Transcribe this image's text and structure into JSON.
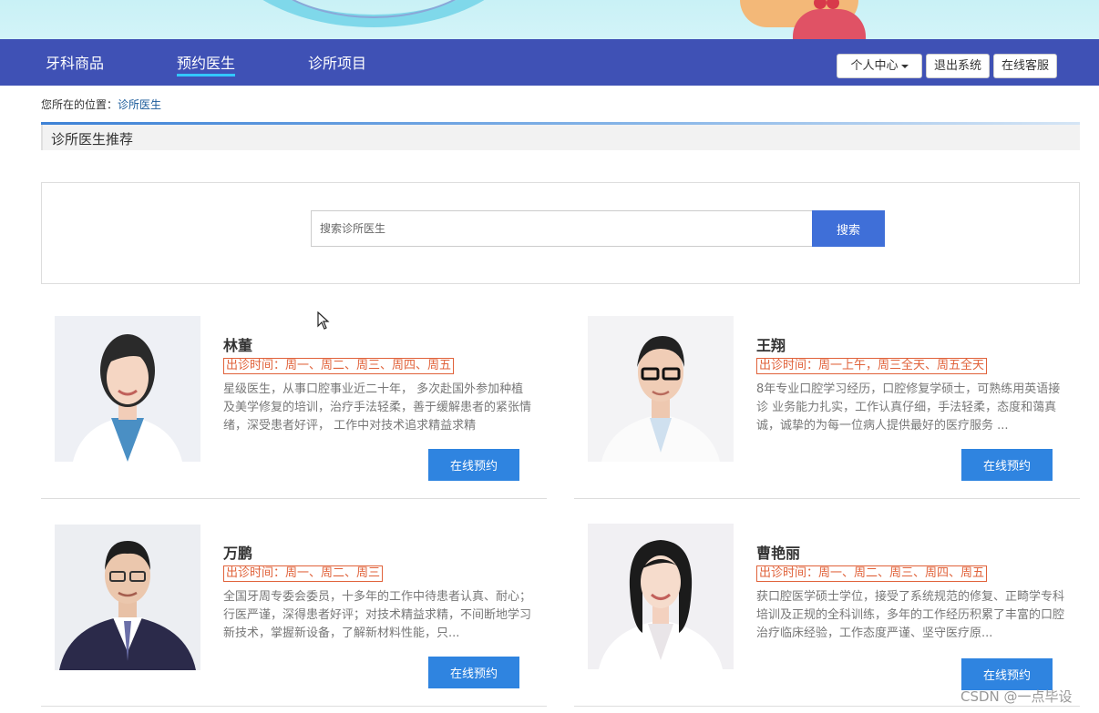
{
  "nav": {
    "items": [
      {
        "label": "牙科商品",
        "active": false
      },
      {
        "label": "预约医生",
        "active": true
      },
      {
        "label": "诊所项目",
        "active": false
      }
    ],
    "user_center": "个人中心",
    "logout": "退出系统",
    "online_service": "在线客服"
  },
  "breadcrumb": {
    "prefix": "您所在的位置：",
    "current": "诊所医生"
  },
  "section": {
    "title": "诊所医生推荐"
  },
  "search": {
    "placeholder": "搜索诊所医生",
    "button": "搜索"
  },
  "doctors": [
    {
      "name": "林董",
      "schedule": "出诊时间：周一、周二、周三、周四、周五",
      "description": "星级医生，从事口腔事业近二十年， 多次赴国外参加种植及美学修复的培训，治疗手法轻柔，善于缓解患者的紧张情绪，深受患者好评， 工作中对技术追求精益求精",
      "book_label": "在线预约"
    },
    {
      "name": "王翔",
      "schedule": "出诊时间：周一上午，周三全天、周五全天",
      "description": "8年专业口腔学习经历，口腔修复学硕士，可熟练用英语接诊 业务能力扎实，工作认真仔细，手法轻柔，态度和蔼真诚，诚挚的为每一位病人提供最好的医疗服务 ...",
      "book_label": "在线预约"
    },
    {
      "name": "万鹏",
      "schedule": "出诊时间：周一、周二、周三",
      "description": "全国牙周专委会委员，十多年的工作中待患者认真、耐心；行医严谨，深得患者好评；对技术精益求精，不间断地学习新技术，掌握新设备，了解新材料性能，只...",
      "book_label": "在线预约"
    },
    {
      "name": "曹艳丽",
      "schedule": "出诊时间：周一、周二、周三、周四、周五",
      "description": "获口腔医学硕士学位，接受了系统规范的修复、正畸学专科培训及正规的全科训练，多年的工作经历积累了丰富的口腔治疗临床经验，工作态度严谨、坚守医疗原...",
      "book_label": "在线预约"
    }
  ],
  "watermark": "CSDN @一点毕设"
}
